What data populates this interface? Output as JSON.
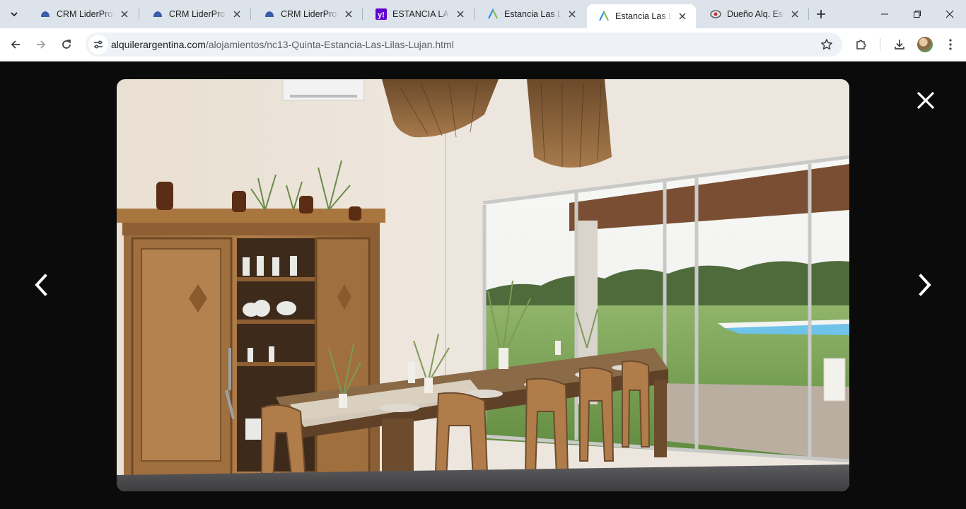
{
  "browser": {
    "tabs": [
      {
        "title": "CRM LiderProp",
        "favicon": "crm-liderprop-favicon",
        "active": false
      },
      {
        "title": "CRM LiderProp",
        "favicon": "crm-liderprop-favicon",
        "active": false
      },
      {
        "title": "CRM LiderProp",
        "favicon": "crm-liderprop-favicon",
        "active": false
      },
      {
        "title": "ESTANCIA LAS LILAS",
        "favicon": "yahoo-favicon",
        "active": false
      },
      {
        "title": "Estancia Las Lilas",
        "favicon": "alquiler-argentina-favicon",
        "active": false
      },
      {
        "title": "Estancia Las Lilas",
        "favicon": "alquiler-argentina-favicon",
        "active": true
      },
      {
        "title": "Dueño Alq. Estancia",
        "favicon": "eye-favicon",
        "active": false
      }
    ],
    "url": {
      "host": "alquilerargentina.com",
      "path": "/alojamientos/nc13-Quinta-Estancia-Las-Lilas-Lujan.html"
    }
  },
  "viewer": {
    "photo_description_icon": "photo-dining-room",
    "controls": [
      "prev-arrow-icon",
      "next-arrow-icon",
      "close-icon"
    ]
  },
  "colors": {
    "tabstrip_bg": "#dde3ea",
    "viewer_bg": "#0b0b0b",
    "yahoo_purple": "#6001d2",
    "crm_blue": "#3b5bab"
  }
}
